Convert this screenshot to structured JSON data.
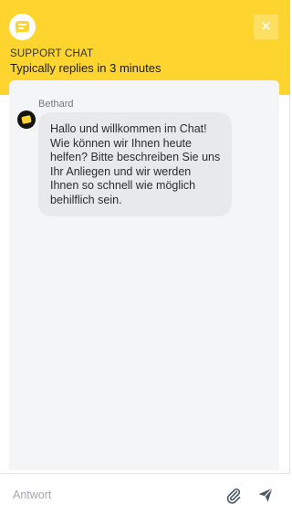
{
  "header": {
    "title": "SUPPORT CHAT",
    "subtitle": "Typically replies in 3 minutes",
    "close_symbol": "✕"
  },
  "messages": [
    {
      "sender": "Bethard",
      "text": "Hallo und willkommen im Chat! Wie können wir Ihnen heute helfen? Bitte beschreiben Sie uns Ihr Anliegen und wir werden Ihnen so schnell wie möglich behilflich sein."
    }
  ],
  "composer": {
    "placeholder": "Antwort"
  },
  "icons": {
    "logo": "chat-bubble-icon",
    "close": "close-icon",
    "attach": "paperclip-icon",
    "send": "send-icon"
  },
  "colors": {
    "brand_yellow": "#fed42e",
    "bubble_bg": "#e8e9ea",
    "messages_bg": "#f4f5f7"
  }
}
